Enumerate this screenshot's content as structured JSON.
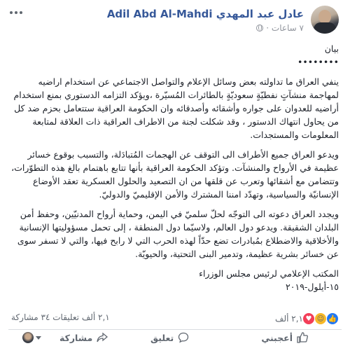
{
  "header": {
    "page_name": "عادل عبد المهدي Adil Abd Al-Mahdi",
    "time_ago": "٧ ساعات ·",
    "privacy_icon": "globe-icon",
    "menu_icon": "more-options-icon"
  },
  "post": {
    "p1": "بيان",
    "p2": "••••••••",
    "p3": "ينفي العراق ما تداولته بعض وسائل الإعلام والتواصل الاجتماعي عن استخدام اراضيه لمهاجمة منشآتٍ نفطيّةٍ سعوديّةٍ بالطائرات المُسيّرة ،ويؤكد التزامه الدستوري بمنع استخدام أراضيه للعدوان على جواره وأشقائه وأصدقائه وان الحكومة العراقية ستتعامل بحزم ضد كل من يحاول انتهاك الدستور ، وقد شكلت لجنة من الاطراف العراقية ذات العلاقة لمتابعة المعلومات والمستجدات.",
    "p4": "ويدعو العراق جميع الأطراف الى التوقف عن الهجمات المُتبادَلة، والتسبب بوقوع خسائر عظيمة في الأرواح والمنشآت. وتؤكد الحكومة العراقية بأنها تتابع باهتمام بالغ هذه التطوّرات، وتتضامن مع أشقائها وتعرب عن قلقها من ان التصعيد والحلول العسكرية تعقد الأوضاع الإنسانيّة والسياسية، وتهدّد امننا المشترك والأمن الإقليميّ والدوليّ.",
    "p5": "ويجدد العراق دعوته الى التوجّه لحلّ سلميّ في اليمن، وحماية أرواح المدنيّين، وحفظ أمن البلدان الشقيقة. ويدعو دول العالم، ولاسيّما دول المنطقة ، إلى تحمل مسؤوليتها الإنسانية والأخلاقية والاضطلاع بمُبادرات تضع حدّاً لهذه الحرب التي لا رابح فيها، والتي لا تسفر سوى عن خسائر بشرية عظيمة، وتدمير البنى التحتية، والحيويّة.",
    "p6": "المكتب الإعلامي لرئيس مجلس الوزراء",
    "p7": "١٥-أيلول-٢٠١٩"
  },
  "stats": {
    "reactions_count": "٢,١ ألف",
    "comments_shares": "٢,١ ألف تعليقات   ٣٤ مشاركة",
    "reaction_icons": [
      "like-icon",
      "haha-icon",
      "love-icon"
    ],
    "colors": {
      "like": "#2078f4",
      "haha": "#f7b928",
      "love": "#f33e58"
    }
  },
  "actions": {
    "like": "أعجبني",
    "comment": "تعليق",
    "share": "مشاركة"
  },
  "colors": {
    "page_name": "#365899",
    "meta": "#90949c",
    "action": "#606770"
  }
}
